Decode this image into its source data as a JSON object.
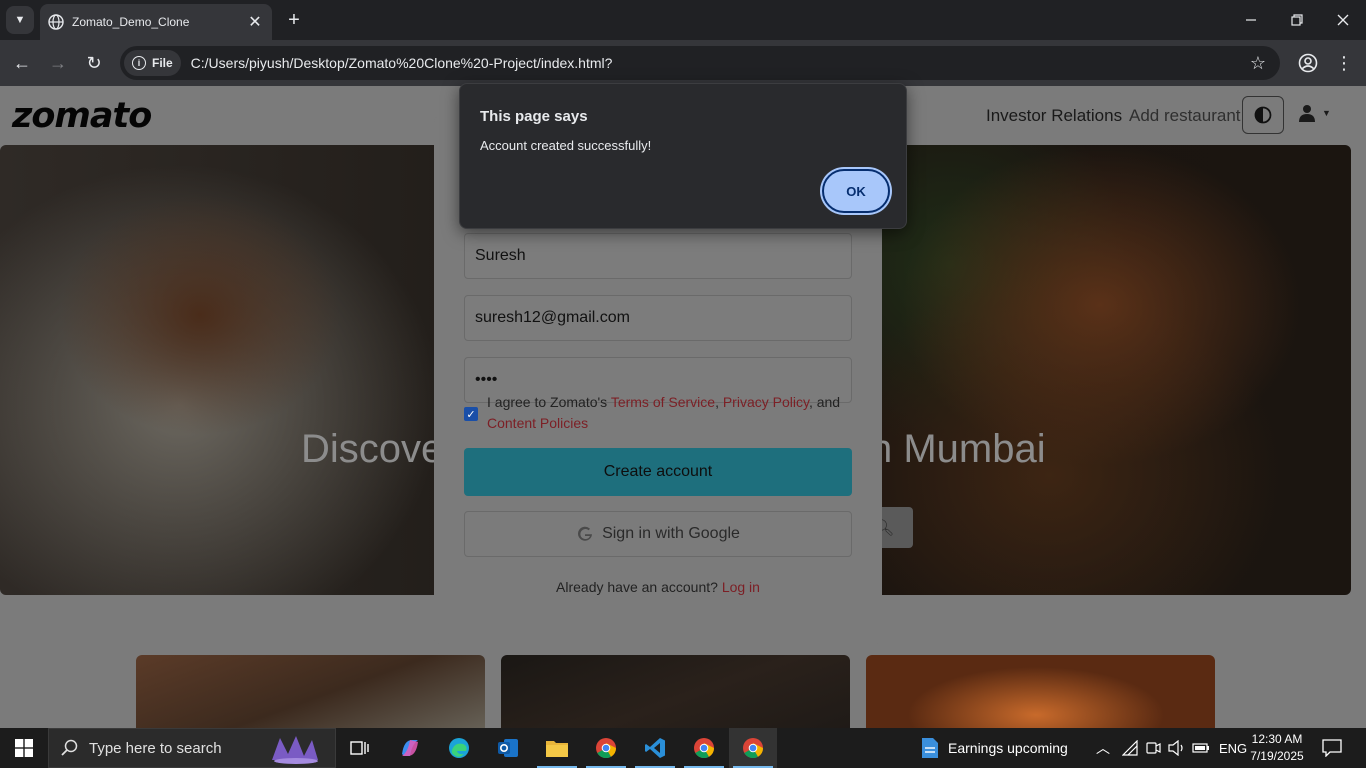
{
  "browser": {
    "tab_title": "Zomato_Demo_Clone",
    "site_chip": "File",
    "url": "C:/Users/piyush/Desktop/Zomato%20Clone%20-Project/index.html?"
  },
  "site": {
    "logo": "zomato",
    "nav": {
      "investor": "Investor Relations",
      "add_restaurant": "Add restaurant"
    },
    "hero": {
      "text_left": "Discove",
      "text_right": "n Mumbai"
    }
  },
  "signup": {
    "name_value": "Suresh",
    "email_value": "suresh12@gmail.com",
    "password_value": "••••",
    "agree_prefix": "I agree to Zomato's ",
    "terms": "Terms of Service",
    "sep1": ", ",
    "privacy": "Privacy Policy",
    "sep2": ", and",
    "content": "Content Policies",
    "create_label": "Create account",
    "google_label": "Sign in with Google",
    "already_text": "Already have an account? ",
    "login_label": "Log in"
  },
  "dialog": {
    "title": "This page says",
    "message": "Account created successfully!",
    "ok_label": "OK"
  },
  "taskbar": {
    "search_placeholder": "Type here to search",
    "news": "Earnings upcoming",
    "language": "ENG",
    "time": "12:30 AM",
    "date": "7/19/2025"
  },
  "colors": {
    "create_button": "#1e6f7d",
    "link": "#7c1f25",
    "ok_button": "#a8c7fa",
    "dialog_bg": "#292a2d"
  }
}
